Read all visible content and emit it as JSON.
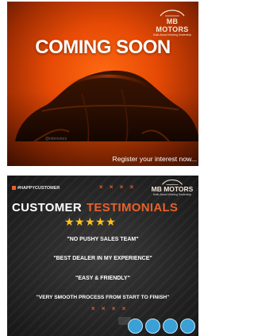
{
  "coming_soon_card": {
    "headline": "COMING SOON",
    "brand_name": "MB MOTORS",
    "brand_tagline": "Multi-Award Winning Dealership",
    "watermark": "@mbmotors",
    "footer": "Register your interest now...",
    "colors": {
      "background": "#e64a05",
      "text": "#ffffff"
    }
  },
  "testimonials_card": {
    "hashtag": "#HAPPYCUSTOMER",
    "decor_top": "× × × ×",
    "decor_bottom": "× × × ×",
    "brand_name": "MB MOTORS",
    "brand_tagline": "Multi-Award Winning Dealership",
    "title_part1": "CUSTOMER",
    "title_part2": "TESTIMONIALS",
    "rating": {
      "stars": "★★★★★",
      "value": 5,
      "max": 5
    },
    "quotes": [
      "\"NO PUSHY SALES TEAM\"",
      "\"BEST DEALER IN MY EXPERIENCE\"",
      "\"EASY & FRIENDLY\"",
      "\"VERY SMOOTH PROCESS FROM START TO FINISH\""
    ],
    "colors": {
      "accent": "#e8612a",
      "stars": "#ffc21a",
      "background": "#262626",
      "badge": "#3aa0d6"
    },
    "award_badge_icons": [
      "award-badge-icon",
      "award-badge-icon",
      "award-badge-icon",
      "award-badge-icon"
    ]
  }
}
